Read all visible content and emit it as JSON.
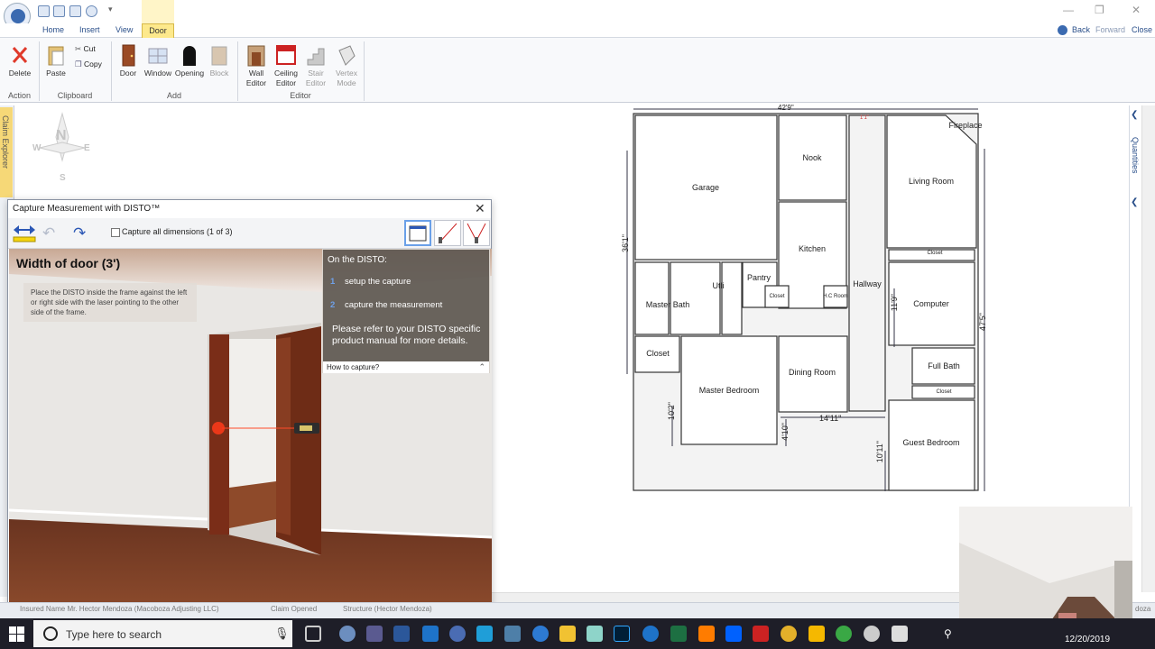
{
  "ribbon_tabs": [
    "Home",
    "Insert",
    "View",
    "Door"
  ],
  "nav": {
    "back": "Back",
    "forward": "Forward",
    "close": "Close"
  },
  "ribbon": {
    "groups": {
      "action": "Action",
      "clipboard": "Clipboard",
      "add": "Add",
      "editor": "Editor"
    },
    "delete": "Delete",
    "paste": "Paste",
    "cut": "Cut",
    "copy": "Copy",
    "door": "Door",
    "window": "Window",
    "opening": "Opening",
    "block": "Block",
    "wall_editor": [
      "Wall",
      "Editor"
    ],
    "ceiling_editor": [
      "Ceiling",
      "Editor"
    ],
    "stair_editor": [
      "Stair",
      "Editor"
    ],
    "vertex_mode": [
      "Vertex",
      "Mode"
    ]
  },
  "sidebar": {
    "claim_explorer": "Claim Explorer",
    "quantities": "Quantities"
  },
  "compass": {
    "n": "N",
    "s": "S",
    "e": "E",
    "w": "W"
  },
  "floorplan": {
    "rooms": [
      "Garage",
      "Nook",
      "Living Room",
      "Fireplace",
      "Kitchen",
      "Hallway",
      "Closet",
      "Computer",
      "Master Bath",
      "Utli",
      "Pantry",
      "Closet",
      "H.C Room",
      "Closet",
      "Master Bedroom",
      "Dining Room",
      "Full Bath",
      "Closet",
      "Guest Bedroom"
    ],
    "dims": {
      "top": "42'9\"",
      "left": "36'1\"",
      "right": "47'5\"",
      "computer_h": "11'9\"",
      "master_bed_h": "10'2\"",
      "dining_h": "4'10\"",
      "dining_w": "14'11\"",
      "guest_h": "10'11\"",
      "top_small": "1'1\""
    }
  },
  "dialog": {
    "title": "Capture Measurement with DISTO™",
    "capture_all": "Capture all dimensions (1 of 3)",
    "heading": "Width of door (3')",
    "note": "Place the DISTO inside the frame against the left or right side with the laser pointing to the other side of the frame.",
    "how": {
      "head": "On the DISTO:",
      "steps": [
        {
          "n": "1",
          "text": "setup the capture"
        },
        {
          "n": "2",
          "text": "capture the measurement"
        }
      ],
      "note": "Please refer to your DISTO specific product manual for more details.",
      "footer": "How to capture?"
    }
  },
  "status": {
    "insured": "Insured Name Mr. Hector Mendoza (Macoboza Adjusting LLC)",
    "claim": "Claim Opened",
    "structure": "Structure (Hector Mendoza)",
    "right": "doza"
  },
  "taskbar": {
    "search": "Type here to search",
    "date": "12/20/2019"
  },
  "colors": {
    "accent": "#2a4f8a",
    "door_tab": "#fde98c",
    "taskbar": "#1e1e28"
  }
}
